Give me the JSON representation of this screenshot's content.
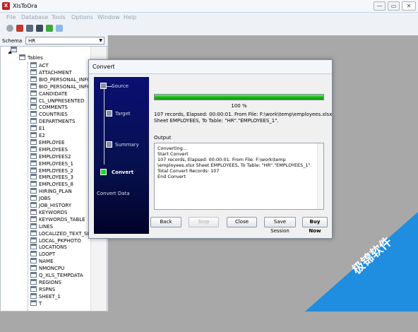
{
  "window": {
    "title": "XlsToOra",
    "app_icon_label": "X",
    "min": "—",
    "max": "▭",
    "close": "✕"
  },
  "menu": [
    "File",
    "Database",
    "Tools",
    "Options",
    "Window",
    "Help"
  ],
  "toolbar_icons": [
    "connect-icon",
    "disconnect-icon",
    "import-icon",
    "export-icon",
    "refresh-icon",
    "grid-icon"
  ],
  "schema": {
    "label": "Schema",
    "value": "HR"
  },
  "tree": {
    "root_expander": "◢",
    "tables_label": "Tables",
    "items": [
      "ACT",
      "ATTACHMENT",
      "BIO_PERSONAL_INFO",
      "BIO_PERSONAL_INFO",
      "CANDIDATE",
      "CL_UNPRESENTED",
      "COMMENTS",
      "COUNTRIES",
      "DEPARTMENTS",
      "E1",
      "E2",
      "EMPLOYEE",
      "EMPLOYEES",
      "EMPLOYEES2",
      "EMPLOYEES_1",
      "EMPLOYEES_2",
      "EMPLOYEES_3",
      "EMPLOYEES_8",
      "HIRING_PLAN",
      "JOBS",
      "JOB_HISTORY",
      "KEYWORDS",
      "KEYWORDS_TABLE",
      "LINES",
      "LOCALIZED_TEXT_SEARCH",
      "LOCAL_PKPHOTO",
      "LOCATIONS",
      "LOOPT",
      "NAME",
      "NMONCPU",
      "Q_XLS_TEMPDATA",
      "REGIONS",
      "RSPNS",
      "SHEET_1",
      "T"
    ]
  },
  "dialog": {
    "title": "Convert",
    "steps": [
      {
        "label": "Source",
        "active": false
      },
      {
        "label": "Target",
        "active": false
      },
      {
        "label": "Summary",
        "active": false
      },
      {
        "label": "Convert",
        "active": true
      }
    ],
    "footer_label": "Convert Data",
    "progress": {
      "value": 1.0,
      "text": "100 %"
    },
    "status_line1": "107 records,    Elapsed: 00:00:01.    From File: F:\\work\\temp\\employees.xlsx",
    "status_line2": "Sheet EMPLOYEES,    To Table: \"HR\".\"EMPLOYEES_1\".",
    "output_label": "Output",
    "output_lines": [
      "Converting...",
      "Start Convert",
      "107 records,    Elapsed: 00:00:01.    From File: F:\\work\\temp",
      "\\employees.xlsx Sheet EMPLOYEES,    To Table: \"HR\".\"EMPLOYEES_1\".",
      "Total Convert Records: 107",
      "End Convert"
    ],
    "buttons": {
      "back": "Back",
      "stop": "Stop",
      "close": "Close",
      "save_session": "Save Session",
      "buy_now": "Buy Now"
    }
  },
  "watermark": {
    "text": "极锦软件",
    "color": "#1f8de0"
  }
}
